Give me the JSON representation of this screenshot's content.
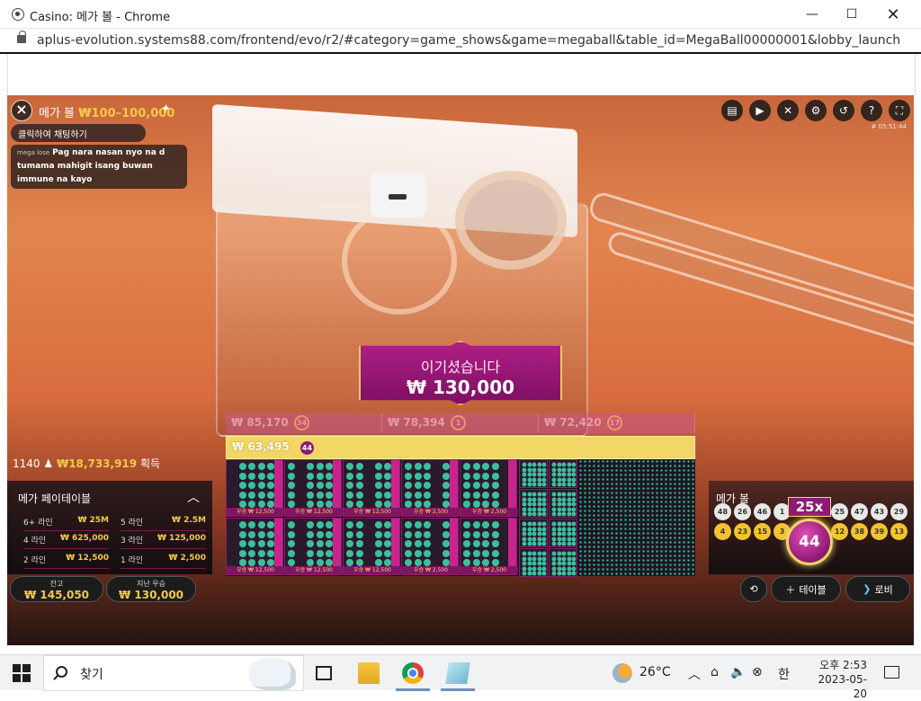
{
  "window": {
    "title": "Casino: 메가 볼 - Chrome",
    "url": "aplus-evolution.systems88.com/frontend/evo/r2/#category=game_shows&game=megaball&table_id=MegaBall00000001&lobby_launch_id=aced00a..."
  },
  "game": {
    "title": "메가 볼",
    "limits": "₩100–100,000",
    "chat_prompt": "클릭하여 채팅하기",
    "chat_user": "mega lose",
    "chat_message": "Pag nara nasan nyo na d tumama mahigit isang buwan immune na kayo",
    "round_id": "# 05:51:44",
    "win_title": "이기셨습니다",
    "win_amount": "₩ 130,000",
    "lines": [
      {
        "amount": "₩ 85,170",
        "ball": "34"
      },
      {
        "amount": "₩ 78,394",
        "ball": "1"
      },
      {
        "amount": "₩ 72,420",
        "ball": "17"
      }
    ],
    "best_line": {
      "amount": "₩ 63,495",
      "ball": "44"
    },
    "players": "1140",
    "total_win": "₩18,733,919",
    "total_win_suffix": "획득"
  },
  "payout": {
    "title": "메가 페이테이블",
    "rows": [
      {
        "label": "6+ 라인",
        "value": "₩ 25M"
      },
      {
        "label": "5 라인",
        "value": "₩ 2.5M"
      },
      {
        "label": "4 라인",
        "value": "₩ 625,000"
      },
      {
        "label": "3 라인",
        "value": "₩ 125,000"
      },
      {
        "label": "2 라인",
        "value": "₩ 12,500"
      },
      {
        "label": "1 라인",
        "value": "₩ 2,500"
      }
    ]
  },
  "balance": {
    "label": "잔고",
    "value": "₩ 145,050"
  },
  "last_win": {
    "label": "지난 우승",
    "value": "₩ 130,000"
  },
  "megaball": {
    "title": "메가 볼",
    "multiplier": "25x",
    "number": "44",
    "balls": [
      "48",
      "26",
      "46",
      "1",
      "4",
      "23",
      "15",
      "3",
      "25",
      "47",
      "43",
      "29",
      "12",
      "38",
      "39",
      "13"
    ]
  },
  "cards": {
    "prizes": [
      "우승 ₩ 12,500",
      "우승 ₩ 12,500",
      "우승 ₩ 12,500",
      "우승 ₩ 2,500",
      "우승 ₩ 2,500",
      "우승 ₩ 12,500",
      "우승 ₩ 12,500",
      "우승 ₩ 12,500",
      "우승 ₩ 2,500",
      "우승 ₩ 2,500"
    ]
  },
  "buttons": {
    "table": "테이블",
    "lobby": "로비"
  },
  "taskbar": {
    "search_placeholder": "찾기",
    "temperature": "26°C",
    "ime": "한",
    "time": "오후 2:53",
    "date": "2023-05-20"
  }
}
